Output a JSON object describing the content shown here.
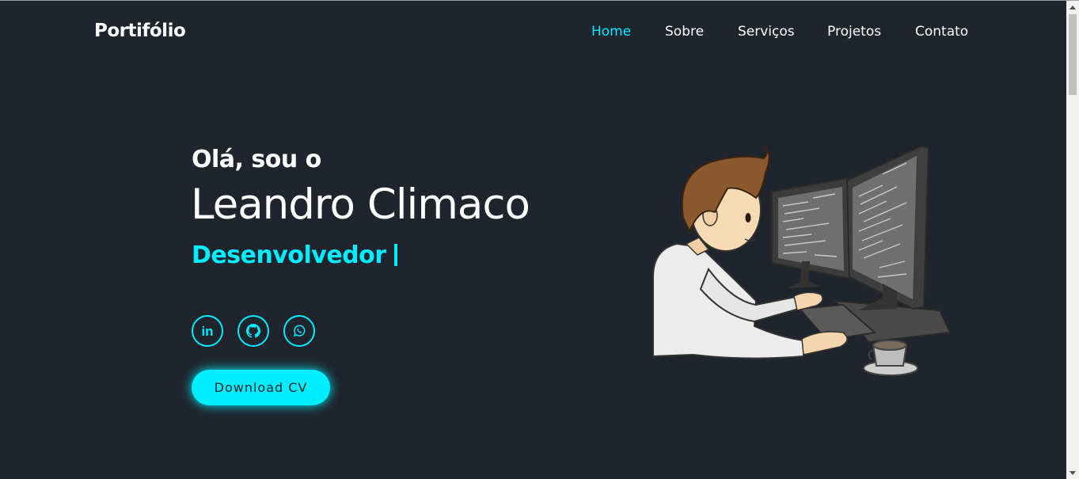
{
  "header": {
    "logo": "Portifólio",
    "nav": [
      {
        "label": "Home",
        "active": true
      },
      {
        "label": "Sobre",
        "active": false
      },
      {
        "label": "Serviços",
        "active": false
      },
      {
        "label": "Projetos",
        "active": false
      },
      {
        "label": "Contato",
        "active": false
      }
    ]
  },
  "hero": {
    "greeting": "Olá, sou o",
    "name": "Leandro Climaco",
    "role": "Desenvolvedor",
    "socials": [
      {
        "icon": "linkedin-icon",
        "glyph": "in"
      },
      {
        "icon": "github-icon"
      },
      {
        "icon": "whatsapp-icon"
      }
    ],
    "cv_button": "Download CV",
    "illustration": "developer-at-computer-illustration"
  },
  "colors": {
    "background": "#1f242d",
    "accent": "#00eeff",
    "text": "#ffffff"
  }
}
